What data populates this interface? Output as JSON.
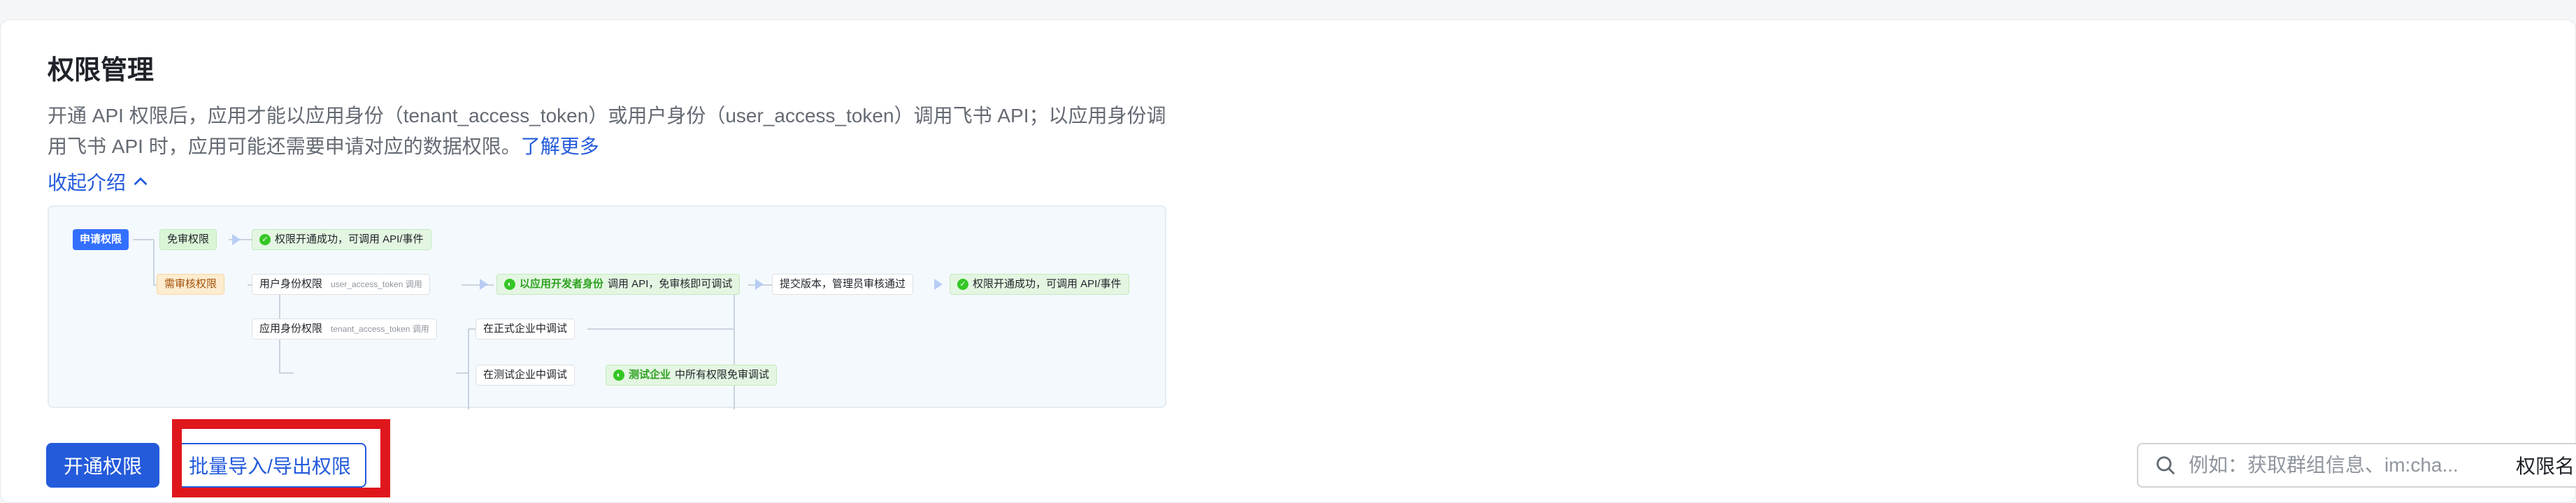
{
  "page": {
    "title": "权限管理",
    "description": "开通 API 权限后，应用才能以应用身份（tenant_access_token）或用户身份（user_access_token）调用飞书 API；以应用身份调用飞书 API 时，应用可能还需要申请对应的数据权限。",
    "learn_more": "了解更多",
    "collapse_label": "收起介绍"
  },
  "diagram": {
    "apply": "申请权限",
    "no_review": "免审权限",
    "success_1": "权限开通成功，可调用 API/事件",
    "need_review": "需审核权限",
    "user_perm": "用户身份权限",
    "user_perm_sub": "user_access_token 调用",
    "dev_identity_hl": "以应用开发者身份",
    "dev_identity_rest": "调用 API，免审核即可调试",
    "submit": "提交版本，管理员审核通过",
    "success_2": "权限开通成功，可调用 API/事件",
    "app_perm": "应用身份权限",
    "app_perm_sub": "tenant_access_token 调用",
    "formal_debug": "在正式企业中调试",
    "test_debug": "在测试企业中调试",
    "test_ent_hl": "测试企业",
    "test_ent_rest": "中所有权限免审调试"
  },
  "toolbar": {
    "enable_button": "开通权限",
    "batch_button": "批量导入/导出权限",
    "search_placeholder": "例如：获取群组信息、im:cha...",
    "filter_label": "权限名"
  },
  "colors": {
    "brand": "#245bdb",
    "highlight": "#e0161d"
  }
}
